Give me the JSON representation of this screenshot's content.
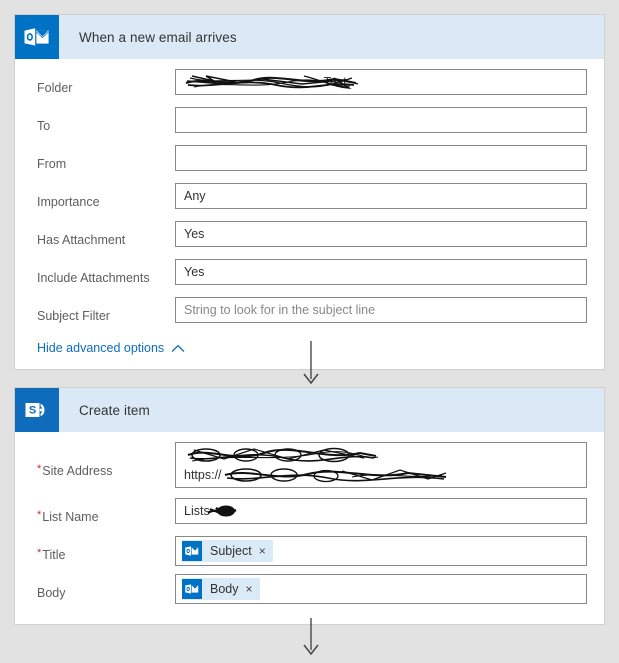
{
  "colors": {
    "canvas_background": "#e2e2e2",
    "card_background": "#ffffff",
    "card_header": "#dbe9f6",
    "outlook_blue": "#0072c6",
    "sharepoint_blue": "#0f6cbd",
    "link_blue": "#0f6cbd",
    "required_red": "#d62728",
    "token_background": "#dbeaf7",
    "label_text": "#605e5c",
    "value_text": "#323130",
    "placeholder_text": "#8a8886",
    "input_border": "#8a8886",
    "arrow": "#4a4a4a"
  },
  "cards": [
    {
      "id": "trigger-card",
      "icon": "outlook-icon",
      "title": "When a new email arrives",
      "fields": [
        {
          "name": "folder",
          "label": "Folder",
          "required": false,
          "value": "Test",
          "redacted_text": "Project Creation Request",
          "redacted": true,
          "type": "text"
        },
        {
          "name": "to",
          "label": "To",
          "required": false,
          "value": "",
          "redacted": false,
          "type": "text"
        },
        {
          "name": "from",
          "label": "From",
          "required": false,
          "value": "",
          "redacted": false,
          "type": "text"
        },
        {
          "name": "importance",
          "label": "Importance",
          "required": false,
          "value": "Any",
          "redacted": false,
          "type": "text"
        },
        {
          "name": "has-attachment",
          "label": "Has Attachment",
          "required": false,
          "value": "Yes",
          "redacted": false,
          "type": "text"
        },
        {
          "name": "include-attachments",
          "label": "Include Attachments",
          "required": false,
          "value": "Yes",
          "redacted": false,
          "type": "text"
        },
        {
          "name": "subject-filter",
          "label": "Subject Filter",
          "required": false,
          "value": "",
          "placeholder": "String to look for in the subject line",
          "redacted": false,
          "type": "text"
        }
      ],
      "advanced_options": {
        "label": "Hide advanced options",
        "icon": "chevron-up-icon"
      }
    },
    {
      "id": "action-card",
      "icon": "sharepoint-icon",
      "title": "Create item",
      "fields": [
        {
          "name": "site-address",
          "label": "Site Address",
          "required": true,
          "value": "",
          "redacted": true,
          "redacted_line_1": "SharePoint Site Name Redacted",
          "redacted_line_2_prefix": "https://",
          "redacted_line_2": "contoso.sharepoint.com/sites/redacted",
          "type": "two-line"
        },
        {
          "name": "list-name",
          "label": "List Name",
          "required": true,
          "value": "Lists",
          "redacted": true,
          "redacted_text": "Lists",
          "type": "text"
        },
        {
          "name": "title",
          "label": "Title",
          "required": true,
          "type": "token",
          "token": {
            "icon": "outlook-icon",
            "label": "Subject",
            "remove": "×"
          }
        },
        {
          "name": "body",
          "label": "Body",
          "required": false,
          "type": "token",
          "token": {
            "icon": "outlook-icon",
            "label": "Body",
            "remove": "×"
          }
        }
      ]
    }
  ],
  "connectors": [
    {
      "name": "connector-trigger-to-action"
    },
    {
      "name": "connector-action-to-next"
    }
  ]
}
